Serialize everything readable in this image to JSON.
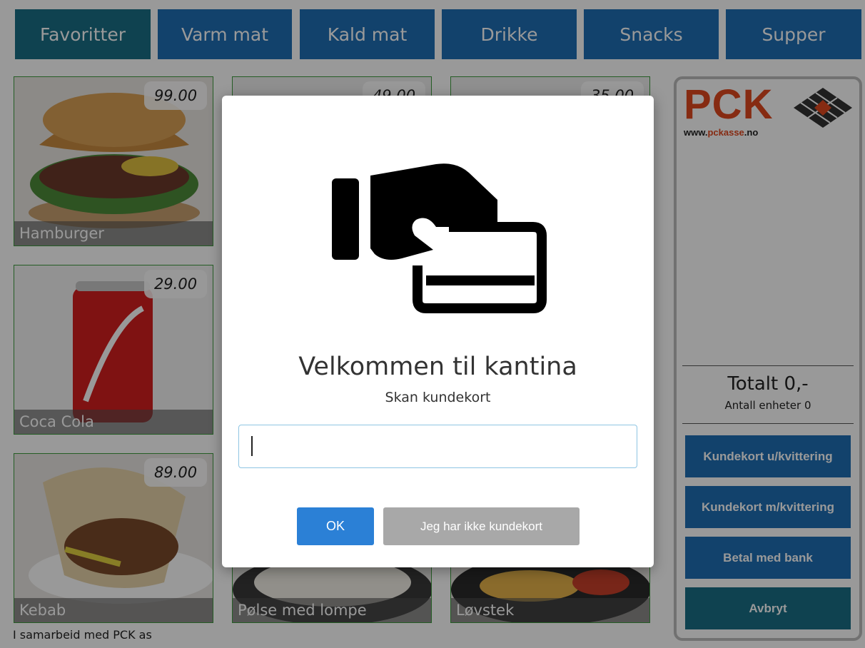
{
  "tabs": [
    {
      "label": "Favoritter",
      "active": true
    },
    {
      "label": "Varm mat"
    },
    {
      "label": "Kald mat"
    },
    {
      "label": "Drikke"
    },
    {
      "label": "Snacks"
    },
    {
      "label": "Supper"
    }
  ],
  "products": [
    {
      "name": "Hamburger",
      "price": "99.00"
    },
    {
      "name": "Coca Cola",
      "price": "29.00"
    },
    {
      "name": "Kebab",
      "price": "89.00"
    },
    {
      "name": "",
      "price": "49.00"
    },
    {
      "name": "Pølse med lompe",
      "price": ""
    },
    {
      "name": "",
      "price": "35.00"
    },
    {
      "name": "Løvstek",
      "price": ""
    }
  ],
  "footer": {
    "note": "I samarbeid med PCK as"
  },
  "panel": {
    "logo_text": "PCK",
    "logo_url_prefix": "www.",
    "logo_url_brand": "pckasse",
    "logo_url_suffix": ".no",
    "total": "Totalt 0,-",
    "units": "Antall enheter 0",
    "buttons": [
      "Kundekort u/kvittering",
      "Kundekort m/kvittering",
      "Betal med bank",
      "Avbryt"
    ]
  },
  "modal": {
    "icon": "hand-card-icon",
    "title": "Velkommen til kantina",
    "subtitle": "Skan kundekort",
    "input_value": "",
    "ok_label": "OK",
    "no_card_label": "Jeg har ikke kundekort"
  },
  "colors": {
    "tab_blue": "#1e6fb4",
    "tab_active": "#196e85",
    "ok_blue": "#2b80d6",
    "logo_orange": "#e0481f"
  }
}
